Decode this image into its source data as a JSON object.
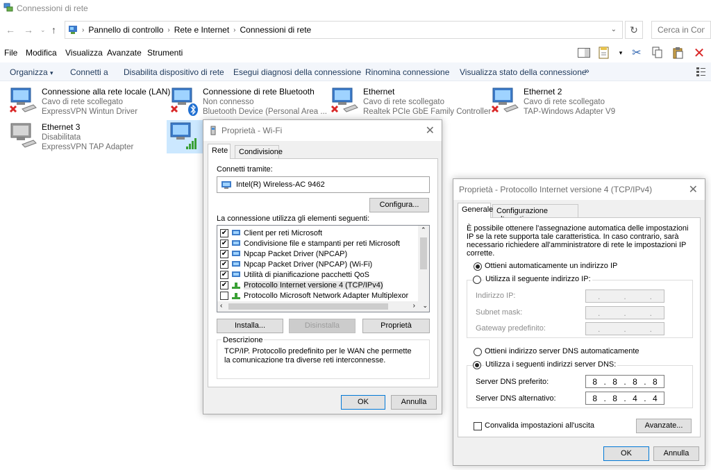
{
  "window": {
    "title": "Connessioni di rete"
  },
  "address": {
    "breadcrumbs": [
      "Pannello di controllo",
      "Rete e Internet",
      "Connessioni di rete"
    ],
    "search_placeholder": "Cerca in Connessioni di rete"
  },
  "menu": [
    "File",
    "Modifica",
    "Visualizza",
    "Avanzate",
    "Strumenti"
  ],
  "commands": {
    "organize": "Organizza",
    "items": [
      "Connetti a",
      "Disabilita dispositivo di rete",
      "Esegui diagnosi della connessione",
      "Rinomina connessione",
      "Visualizza stato della connessione"
    ],
    "more": "»"
  },
  "connections": [
    {
      "name": "Connessione alla rete locale (LAN)",
      "status": "Cavo di rete scollegato",
      "device": "ExpressVPN Wintun Driver",
      "badge": "red-x"
    },
    {
      "name": "Connessione di rete Bluetooth",
      "status": "Non connesso",
      "device": "Bluetooth Device (Personal Area ...",
      "badge": "red-x"
    },
    {
      "name": "Ethernet",
      "status": "Cavo di rete scollegato",
      "device": "Realtek PCIe GbE Family Controller",
      "badge": "red-x"
    },
    {
      "name": "Ethernet 2",
      "status": "Cavo di rete scollegato",
      "device": "TAP-Windows Adapter V9",
      "badge": "red-x"
    },
    {
      "name": "Ethernet 3",
      "status": "Disabilitata",
      "device": "ExpressVPN TAP Adapter",
      "badge": "none"
    }
  ],
  "wifi_dialog": {
    "title": "Proprietà - Wi-Fi",
    "tabs": [
      "Rete",
      "Condivisione"
    ],
    "connect_using_label": "Connetti tramite:",
    "adapter": "Intel(R) Wireless-AC 9462",
    "configure_button": "Configura...",
    "items_label": "La connessione utilizza gli elementi seguenti:",
    "items": [
      {
        "label": "Client per reti Microsoft",
        "checked": true
      },
      {
        "label": "Condivisione file e stampanti per reti Microsoft",
        "checked": true
      },
      {
        "label": "Npcap Packet Driver (NPCAP)",
        "checked": true
      },
      {
        "label": "Npcap Packet Driver (NPCAP) (Wi-Fi)",
        "checked": true
      },
      {
        "label": "Utilità di pianificazione pacchetti QoS",
        "checked": true
      },
      {
        "label": "Protocollo Internet versione 4 (TCP/IPv4)",
        "checked": true
      },
      {
        "label": "Protocollo Microsoft Network Adapter Multiplexor",
        "checked": false
      }
    ],
    "install_button": "Installa...",
    "uninstall_button": "Disinstalla",
    "properties_button": "Proprietà",
    "description_label": "Descrizione",
    "description": "TCP/IP. Protocollo predefinito per le WAN che permette la comunicazione tra diverse reti interconnesse.",
    "ok": "OK",
    "cancel": "Annulla"
  },
  "ipv4_dialog": {
    "title": "Proprietà - Protocollo Internet versione 4 (TCP/IPv4)",
    "tabs": [
      "Generale",
      "Configurazione alternativa"
    ],
    "intro": "È possibile ottenere l'assegnazione automatica delle impostazioni IP se la rete supporta tale caratteristica. In caso contrario, sarà necessario richiedere all'amministratore di rete le impostazioni IP corrette.",
    "auto_ip": "Ottieni automaticamente un indirizzo IP",
    "manual_ip": "Utilizza il seguente indirizzo IP:",
    "ip_address_label": "Indirizzo IP:",
    "subnet_label": "Subnet mask:",
    "gateway_label": "Gateway predefinito:",
    "ip_address": [
      ".",
      ".",
      "."
    ],
    "auto_dns": "Ottieni indirizzo server DNS automaticamente",
    "manual_dns": "Utilizza i seguenti indirizzi server DNS:",
    "preferred_dns_label": "Server DNS preferito:",
    "alternate_dns_label": "Server DNS alternativo:",
    "preferred_dns": [
      "8",
      "8",
      "8",
      "8"
    ],
    "alternate_dns": [
      "8",
      "8",
      "4",
      "4"
    ],
    "validate_label": "Convalida impostazioni all'uscita",
    "advanced_button": "Avanzate...",
    "ok": "OK",
    "cancel": "Annulla",
    "ip_mode": "auto",
    "dns_mode": "manual"
  },
  "colors": {
    "accent": "#0078d7",
    "error": "#d92727",
    "cmdbar_bg": "#f3f6fb",
    "dialog_bg": "#f0f0f0"
  }
}
